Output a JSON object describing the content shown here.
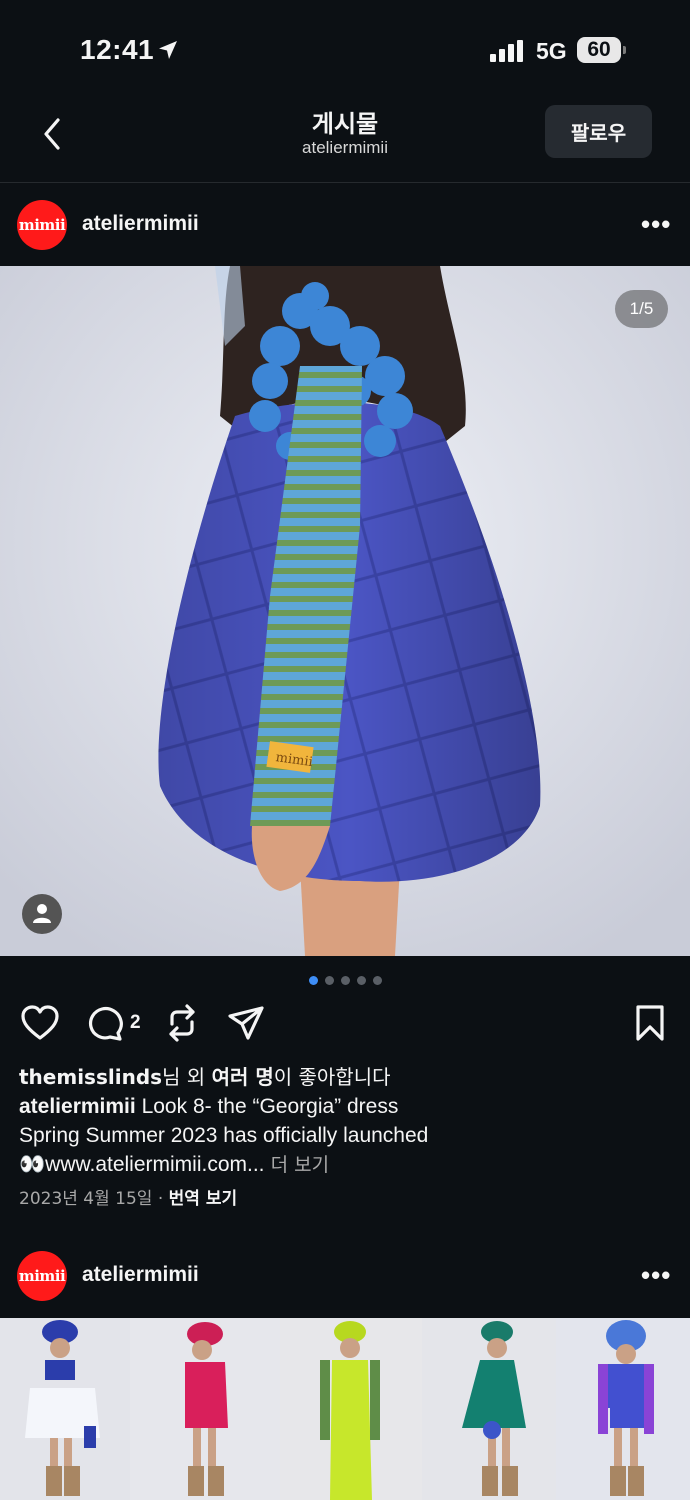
{
  "status_bar": {
    "time": "12:41",
    "network": "5G",
    "battery": "60"
  },
  "header": {
    "title": "게시물",
    "subtitle": "ateliermimii",
    "follow_label": "팔로우"
  },
  "post": {
    "avatar_text": "mimii",
    "username": "ateliermimii",
    "more": "•••",
    "image_counter": "1/5",
    "carousel": {
      "count": 5,
      "active_index": 0
    },
    "comment_count": "2",
    "likes": {
      "user": "themisslinds",
      "mid": "님 외 ",
      "others": "여러 명",
      "end": "이 좋아합니다"
    },
    "caption": {
      "username": "ateliermimii",
      "line1": " Look 8- the “Georgia” dress",
      "line2": "Spring Summer 2023 has officially launched",
      "line3_emoji": "👀",
      "line3": "www.ateliermimii.com...",
      "more_label": " 더 보기"
    },
    "date": "2023년 4월 15일",
    "separator": " · ",
    "translate_label": "번역 보기"
  },
  "next_post": {
    "avatar_text": "mimii",
    "username": "ateliermimii",
    "more": "•••"
  },
  "colors": {
    "background": "#0c1014",
    "accent_blue": "#3e8ef7",
    "avatar_red": "#ff1a1a",
    "dress_blue": "#4b55c4"
  }
}
